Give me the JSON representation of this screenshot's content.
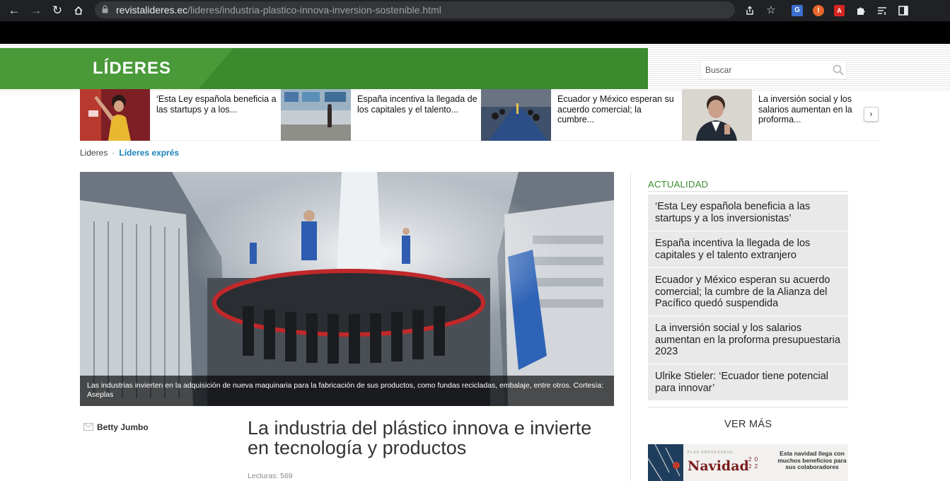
{
  "browser": {
    "url_host": "revistalideres.ec",
    "url_path": "/lideres/industria-plastico-innova-inversion-sostenible.html"
  },
  "site": {
    "logo": "LÍDERES",
    "search_placeholder": "Buscar"
  },
  "teasers": [
    {
      "title": "‘Esta Ley española beneficia a las startups y a los..."
    },
    {
      "title": "España incentiva la llegada de los capitales y el talento..."
    },
    {
      "title": "Ecuador y México esperan su acuerdo comercial; la cumbre..."
    },
    {
      "title": "La inversión social y los salarios aumentan en la proforma..."
    }
  ],
  "breadcrumb": {
    "home": "Lideres",
    "separator": "·",
    "current": "Líderes exprés"
  },
  "article": {
    "caption": "Las industrias invierten en la adquisición de nueva maquinaria para la fabricación de sus productos, como fundas recicladas, embalaje, entre otros. Cortesía: Aseplas",
    "author": "Betty Jumbo",
    "headline": "La industria del plástico innova e invierte en tecnología y productos",
    "reads": "Lecturas: 569"
  },
  "sidebar": {
    "heading": "ACTUALIDAD",
    "items": [
      "‘Esta Ley española beneficia a las startups y a los inversionistas’",
      "España incentiva la llegada de los capitales y el talento extranjero",
      "Ecuador y México esperan su acuerdo comercial; la cumbre de la Alianza del Pacífico quedó suspendida",
      "La inversión social y los salarios aumentan en la proforma presupuestaria 2023",
      "Ulrike Stieler: ‘Ecuador tiene potencial para innovar’"
    ],
    "more": "VER MÁS"
  },
  "banner": {
    "kicker": "PLAN EMPRESARIAL",
    "title": "Navidad",
    "year": "2 0\n2 2",
    "text": "Esta navidad llega con muchos beneficios para sus colaboradores"
  },
  "colors": {
    "brand_green": "#3b8a2e",
    "link_blue": "#1a80b8",
    "chrome_dark": "#202124"
  },
  "icons": [
    "back-arrow-icon",
    "forward-arrow-icon",
    "reload-icon",
    "home-icon",
    "lock-icon",
    "share-icon",
    "bookmark-star-icon",
    "translate-icon",
    "extension-warning-icon",
    "pdf-icon",
    "puzzle-icon",
    "reading-list-icon",
    "side-panel-icon",
    "search-icon",
    "chevron-right-icon",
    "mail-icon"
  ]
}
